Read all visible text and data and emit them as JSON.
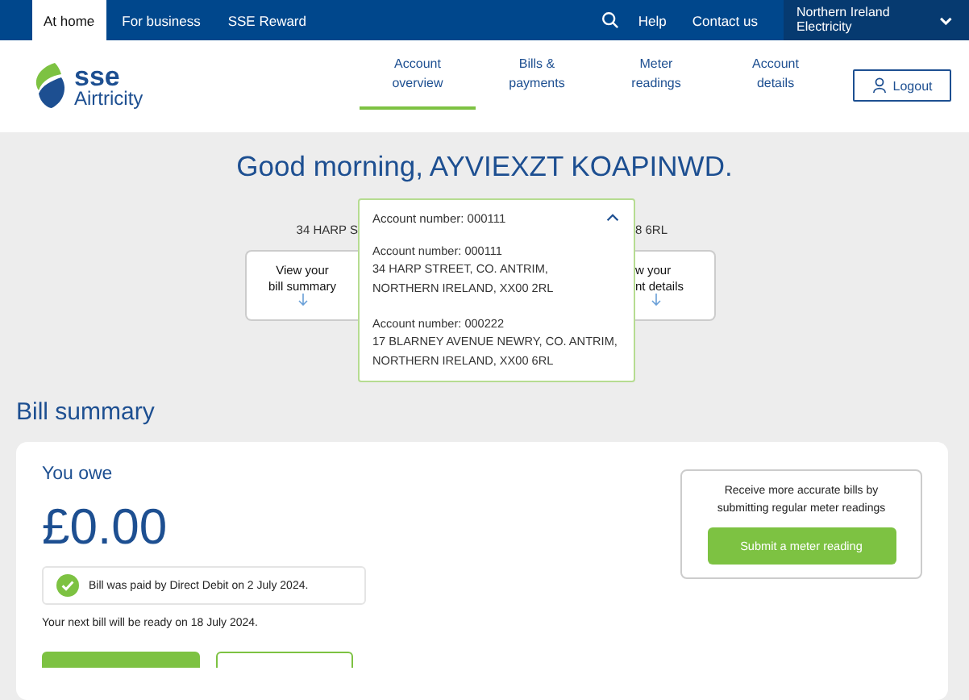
{
  "top_bar": {
    "tabs": [
      {
        "label": "At home",
        "selected": true
      },
      {
        "label": "For business",
        "selected": false
      },
      {
        "label": "SSE Reward",
        "selected": false
      }
    ],
    "links": [
      "Help",
      "Contact us"
    ],
    "region": {
      "label": "Northern Ireland Electricity"
    }
  },
  "header": {
    "logo": {
      "line_1": "sse",
      "line_2": "Airtricity"
    },
    "nav": [
      {
        "label": "Account overview",
        "selected": true
      },
      {
        "label": "Bills & payments",
        "selected": false
      },
      {
        "label": "Meter readings",
        "selected": false
      },
      {
        "label": "Account details",
        "selected": false
      }
    ],
    "logout": "Logout"
  },
  "greeting": "Good morning, AYVIEXZT KOAPINWD.",
  "behind_dropdown": {
    "address_left": "34 HARP S",
    "address_right": "8 6RL",
    "card_left": [
      "View your",
      "bill summary"
    ],
    "card_right": [
      "w your",
      "nt details"
    ]
  },
  "account_dropdown": {
    "value": "Account number: 000111",
    "expanded": true,
    "options": [
      {
        "account": "Account number: 000111",
        "address_lines": [
          "34 HARP STREET, CO. ANTRIM,",
          "NORTHERN IRELAND, XX00 2RL"
        ]
      },
      {
        "account": "Account number: 000222",
        "address_lines": [
          "17 BLARNEY AVENUE NEWRY, CO. ANTRIM,",
          "NORTHERN IRELAND, XX00 6RL"
        ]
      }
    ]
  },
  "bill_summary": {
    "title": "Bill summary",
    "you_owe": "You owe",
    "amount": "£0.00",
    "notice": "Bill was paid by Direct Debit on 2 July 2024.",
    "next_bill": "Your next bill will be ready on 18 July 2024.",
    "promo": {
      "text": "Receive more accurate bills by submitting regular meter readings",
      "button": "Submit a meter reading"
    }
  }
}
